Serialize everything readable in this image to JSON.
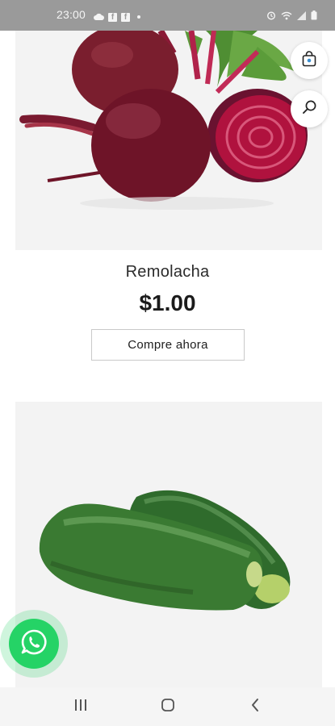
{
  "status_bar": {
    "time": "23:00",
    "icons": [
      "cloud-icon",
      "facebook-icon",
      "facebook-icon",
      "dot-icon",
      "alarm-icon",
      "wifi-icon",
      "signal-icon",
      "battery-icon"
    ]
  },
  "products": [
    {
      "name": "Remolacha",
      "price": "$1.00",
      "button_label": "Compre ahora",
      "image": "beetroot-image"
    },
    {
      "image": "cucumber-image"
    }
  ],
  "floating_buttons": {
    "cart_icon": "shopping-bag-icon",
    "search_icon": "search-icon",
    "whatsapp_icon": "whatsapp-icon"
  },
  "nav_bar": {
    "icons": [
      "recents-icon",
      "home-icon",
      "back-icon"
    ]
  },
  "colors": {
    "status_bar": "#9a9a9a",
    "whatsapp": "#25d366",
    "cart_dot": "#3b8fd1",
    "image_bg": "#f3f3f3"
  }
}
